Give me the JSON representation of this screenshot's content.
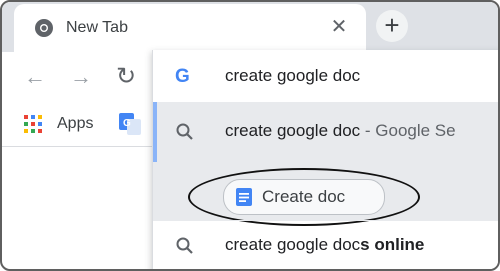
{
  "tab": {
    "title": "New Tab",
    "close_glyph": "✕",
    "favicon": "chrome-icon"
  },
  "new_tab_glyph": "+",
  "nav": {
    "back": "←",
    "forward": "→",
    "reload": "↻"
  },
  "bookmarks": {
    "apps_label": "Apps",
    "translate_icon": "translate-icon"
  },
  "omnibox": {
    "google_letter": "G",
    "query": "create google doc"
  },
  "suggestions": [
    {
      "text": "create google doc",
      "source": " - Google Se",
      "icon": "search-icon"
    },
    {
      "text": "create google doc",
      "bold_suffix": "s online",
      "icon": "search-icon"
    }
  ],
  "action_chip": {
    "label": "Create doc",
    "icon": "docs-icon"
  },
  "colors": {
    "tabstrip": "#dee1e6",
    "highlight": "#e8eaed",
    "accent": "#8ab4f8",
    "docs_blue": "#4285f4"
  }
}
